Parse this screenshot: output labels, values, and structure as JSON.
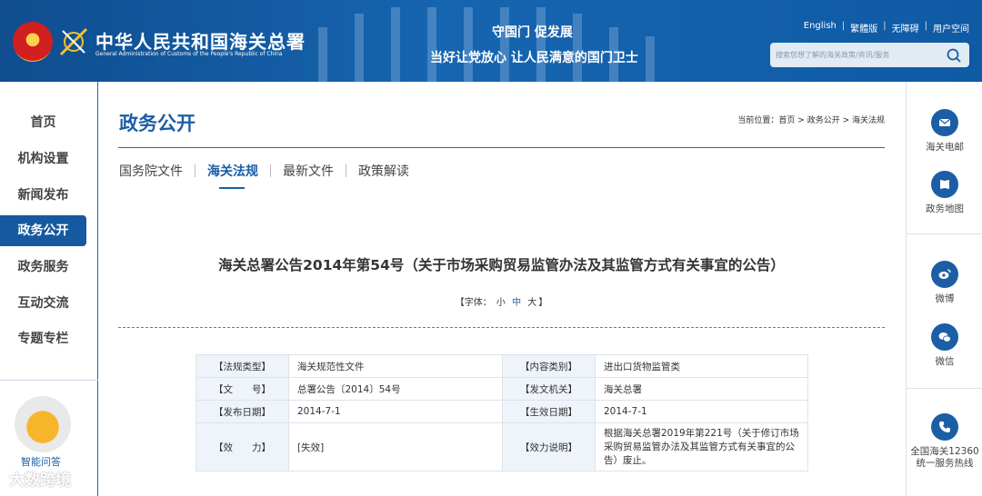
{
  "header": {
    "org_name_cn": "中华人民共和国海关总署",
    "org_name_en": "General Administration of Customs of the People's Republic of China",
    "slogan_line1": "守国门  促发展",
    "slogan_line2": "当好让党放心  让人民满意的国门卫士",
    "links": [
      "English",
      "繁體版",
      "无障碍",
      "用户空间"
    ],
    "search_placeholder": "搜索您想了解的海关政策/资讯/服务",
    "brand_color": "#1659a0"
  },
  "left_nav": {
    "items": [
      "首页",
      "机构设置",
      "新闻发布",
      "政务公开",
      "政务服务",
      "互动交流",
      "专题专栏"
    ],
    "active_index": 3,
    "mascot_label": "智能问答"
  },
  "main": {
    "section_title": "政务公开",
    "breadcrumb": {
      "prefix": "当前位置：",
      "items": [
        "首页",
        "政务公开",
        "海关法规"
      ],
      "separator": " > "
    },
    "subtabs": [
      "国务院文件",
      "海关法规",
      "最新文件",
      "政策解读"
    ],
    "active_subtab": 1,
    "doc_title": "海关总署公告2014年第54号（关于市场采购贸易监管办法及其监管方式有关事宜的公告）",
    "font_size": {
      "label": "【字体：",
      "options": [
        "小",
        "中",
        "大"
      ],
      "suffix": "】"
    },
    "meta_table": [
      {
        "k1": "【法规类型】",
        "v1": "海关规范性文件",
        "k2": "【内容类别】",
        "v2": "进出口货物监管类"
      },
      {
        "k1": "【文　　号】",
        "v1": "总署公告〔2014〕54号",
        "k2": "【发文机关】",
        "v2": "海关总署"
      },
      {
        "k1": "【发布日期】",
        "v1": "2014-7-1",
        "k2": "【生效日期】",
        "v2": "2014-7-1"
      },
      {
        "k1": "【效　　力】",
        "v1": "[失效]",
        "k2": "【效力说明】",
        "v2": "根据海关总署2019年第221号（关于修订市场采购贸易监管办法及其监管方式有关事宜的公告）废止。"
      }
    ]
  },
  "right_rail": {
    "items": [
      {
        "label": "海关电邮",
        "icon": "mail-icon"
      },
      {
        "label": "政务地图",
        "icon": "map-icon"
      },
      {
        "label": "微博",
        "icon": "weibo-icon"
      },
      {
        "label": "微信",
        "icon": "wechat-icon"
      },
      {
        "label": "全国海关12360",
        "label2": "统一服务热线",
        "icon": "phone-icon"
      }
    ]
  },
  "watermark": "大数跨境"
}
